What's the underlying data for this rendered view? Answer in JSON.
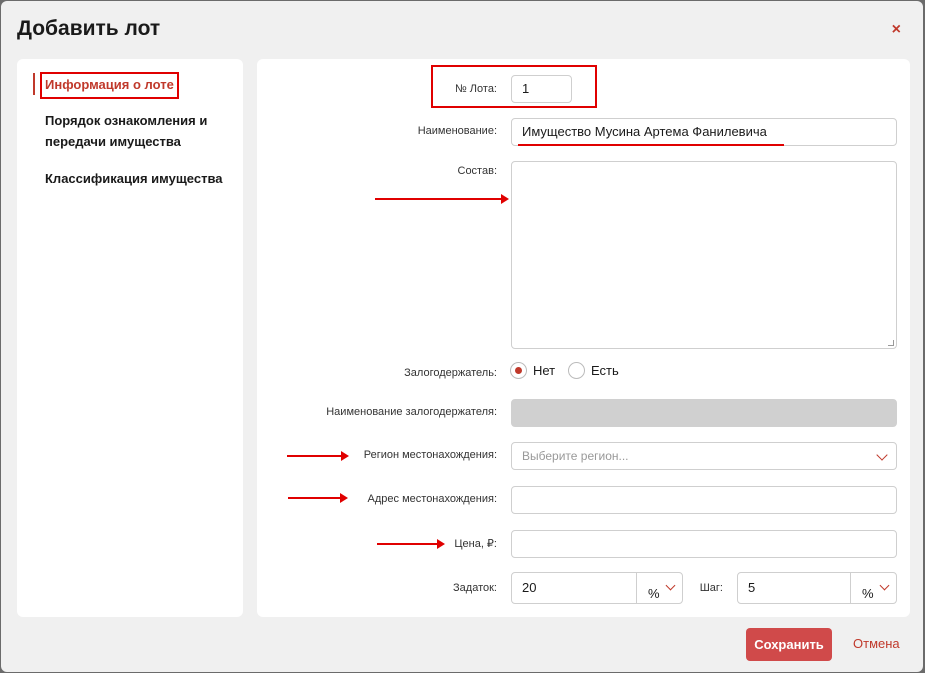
{
  "modal": {
    "title": "Добавить лот",
    "close": "×"
  },
  "sidebar": {
    "items": [
      {
        "label": "Информация о лоте",
        "active": true
      },
      {
        "label": "Порядок ознакомления и передачи имущества",
        "active": false
      },
      {
        "label": "Классификация имущества",
        "active": false
      }
    ]
  },
  "form": {
    "lot_number": {
      "label": "№ Лота:",
      "value": "1"
    },
    "name": {
      "label": "Наименование:",
      "value": "Имущество Мусина Артема Фанилевича"
    },
    "composition": {
      "label": "Состав:",
      "value": ""
    },
    "pledge_holder": {
      "label": "Залогодержатель:",
      "options": [
        {
          "label": "Нет",
          "checked": true
        },
        {
          "label": "Есть",
          "checked": false
        }
      ]
    },
    "pledge_holder_name": {
      "label": "Наименование залогодержателя:",
      "value": ""
    },
    "region": {
      "label": "Регион местонахождения:",
      "placeholder": "Выберите регион..."
    },
    "address": {
      "label": "Адрес местонахождения:",
      "value": ""
    },
    "price": {
      "label": "Цена, ₽:",
      "value": ""
    },
    "deposit": {
      "label": "Задаток:",
      "value": "20",
      "unit": "%"
    },
    "step": {
      "label": "Шаг:",
      "value": "5",
      "unit": "%"
    }
  },
  "actions": {
    "save": "Сохранить",
    "cancel": "Отмена"
  },
  "colors": {
    "accent": "#c0392b",
    "annotation": "#e00000",
    "save_button": "#d04a4a"
  }
}
